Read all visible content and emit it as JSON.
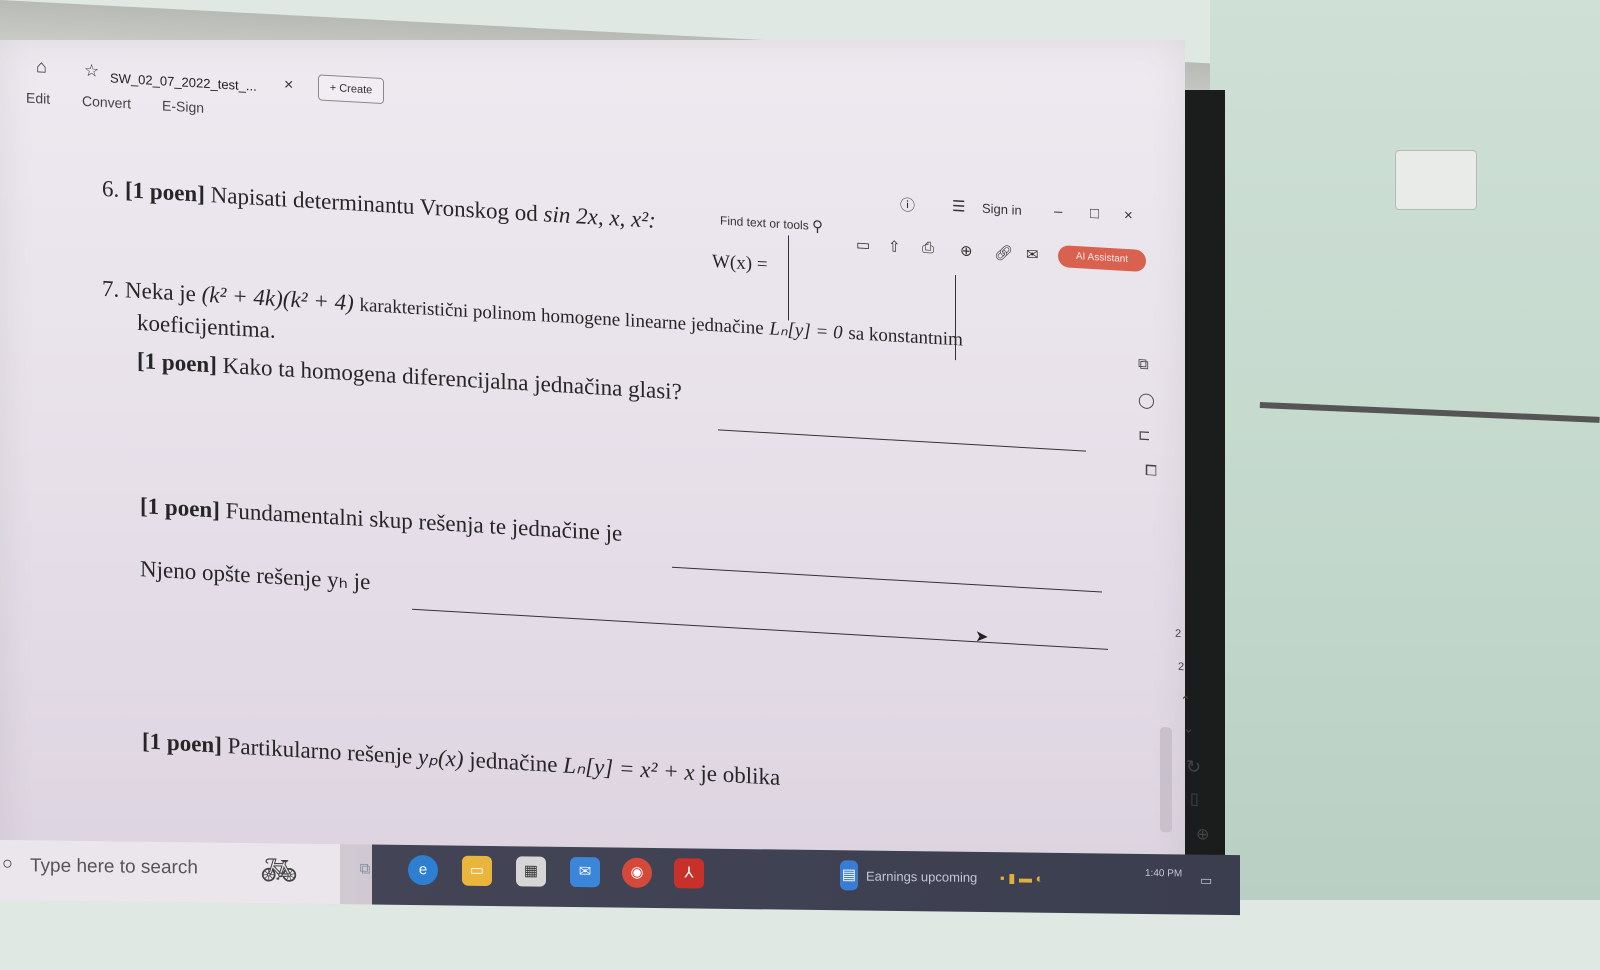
{
  "browser": {
    "tab_title": "SW_02_07_2022_test_...",
    "tab_close": "×",
    "create_label": "Create",
    "create_plus": "+",
    "menu": [
      "Edit",
      "Convert",
      "E-Sign"
    ],
    "find_placeholder": "Find text or tools",
    "sign_in": "Sign in",
    "ai_assistant": "AI Assistant",
    "window_controls": [
      "–",
      "□",
      "×"
    ]
  },
  "icons": {
    "home": "home-icon",
    "star": "star-icon",
    "search": "search-icon",
    "info": "info-icon",
    "menu": "hamburger-icon",
    "upload": "upload-icon",
    "print": "print-icon",
    "zoom": "zoom-icon",
    "link": "link-icon",
    "mail": "mail-icon"
  },
  "document": {
    "q6_number": "6.",
    "q6_points": "[1 poen]",
    "q6_text": "Napisati determinantu Vronskog od",
    "q6_funcs": "sin 2x, x, x²:",
    "q6_w": "W(x) =",
    "q7_number": "7.",
    "q7_intro": "Neka je",
    "q7_poly": "(k² + 4k)(k² + 4)",
    "q7_text": "karakteristični polinom homogene linearne jednačine",
    "q7_eq": "Lₙ[y] = 0",
    "q7_tail": "sa konstantnim",
    "q7_line2": "koeficijentima.",
    "part_a_points": "[1 poen]",
    "part_a_text": "Kako ta homogena diferencijalna jednačina glasi?",
    "part_b_points": "[1 poen]",
    "part_b_text": "Fundamentalni skup rešenja te jednačine je",
    "part_c_text": "Njeno opšte rešenje yₕ je",
    "part_d_points": "[1 poen]",
    "part_d_text": "Partikularno rešenje",
    "part_d_yp": "yₚ(x)",
    "part_d_eq_pre": "jednačine",
    "part_d_eq": "Lₙ[y] = x² + x",
    "part_d_tail": "je oblika"
  },
  "page_indicators": [
    "2",
    "2"
  ],
  "taskbar": {
    "search_placeholder": "Type here to search",
    "weather": "Earnings upcoming",
    "time": "1:40 PM",
    "apps": [
      "task-view",
      "edge",
      "file-explorer",
      "store",
      "mail",
      "chrome",
      "acrobat"
    ]
  },
  "colors": {
    "ai_button": "#d9614f",
    "taskbar": "#3b3e4f",
    "screen": "#e7e0e9"
  }
}
